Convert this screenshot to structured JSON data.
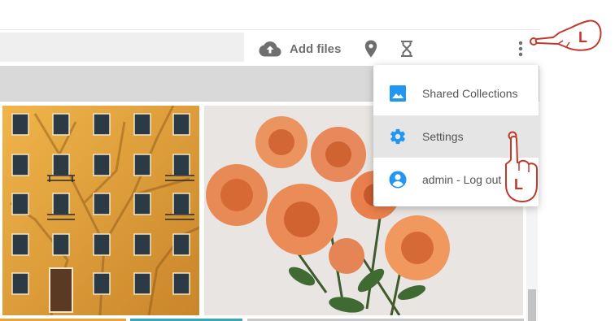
{
  "header": {
    "add_files_label": "Add files",
    "search_placeholder": ""
  },
  "menu": {
    "items": [
      {
        "label": "Shared Collections",
        "icon": "image-icon"
      },
      {
        "label": "Settings",
        "icon": "gear-icon"
      },
      {
        "label": "admin - Log out",
        "icon": "account-icon"
      }
    ],
    "highlighted_index": 1
  },
  "cursor_hints": {
    "more_menu_letter": "L",
    "settings_letter": "L"
  },
  "colors": {
    "accent": "#2196f3",
    "icon_gray": "#6f6f6f",
    "hand_red": "#c0392b"
  }
}
